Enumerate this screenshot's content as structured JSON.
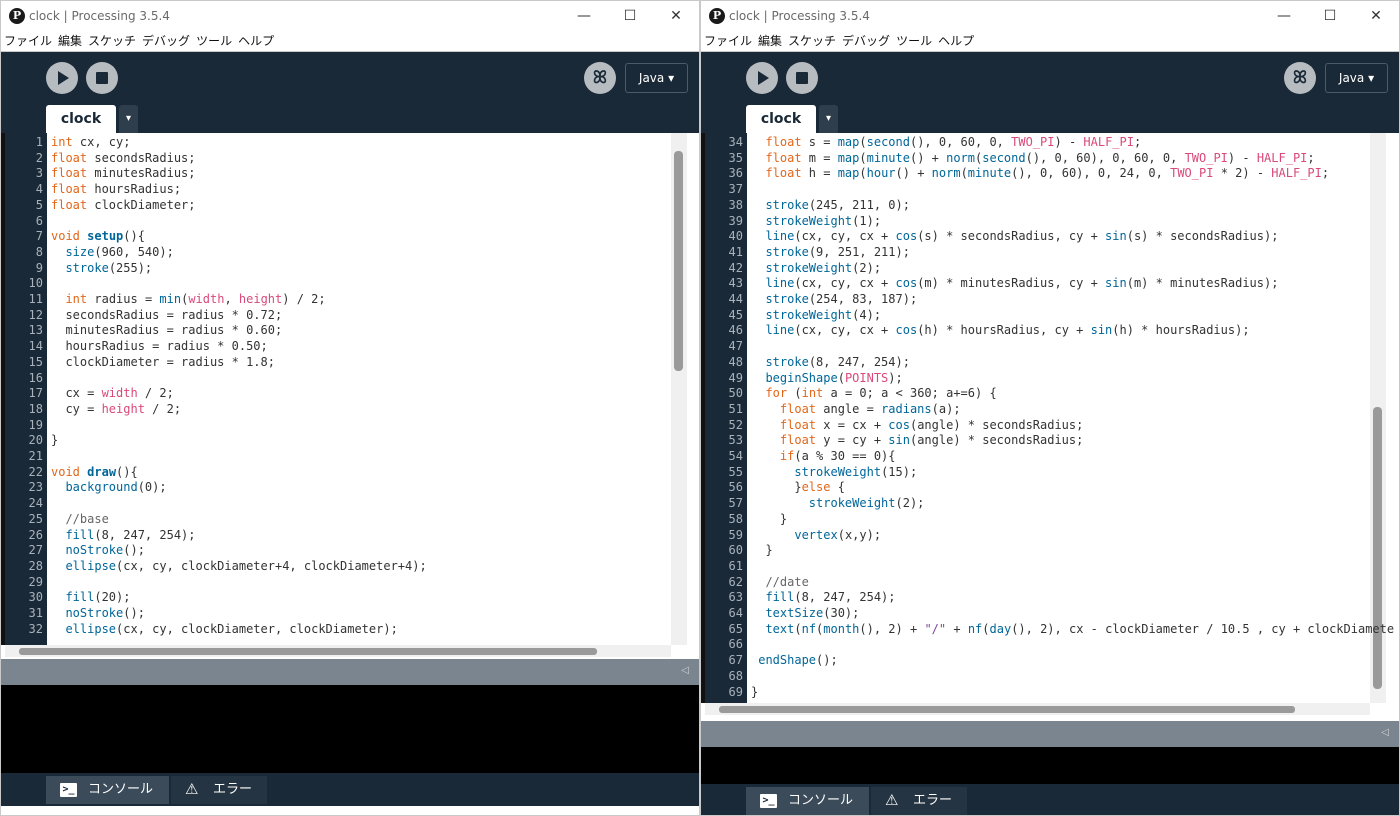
{
  "left": {
    "title": "clock | Processing 3.5.4",
    "app_icon": "P",
    "icons": {
      "minimize": "minimize-icon",
      "maximize": "maximize-icon",
      "close": "close-icon"
    },
    "window_controls": {
      "minimize": "—",
      "maximize": "☐",
      "close": "✕"
    },
    "menu": [
      "ファイル",
      "編集",
      "スケッチ",
      "デバッグ",
      "ツール",
      "ヘルプ"
    ],
    "mode_label": "Java ▾",
    "tab": {
      "label": "clock",
      "menu": "▾"
    },
    "footer": {
      "console": "コンソール",
      "errors": "エラー",
      "console_glyph": ">_",
      "errors_glyph": "⚠"
    },
    "collapse_glyph": "◁",
    "code": [
      {
        "n": "1",
        "t": [
          [
            "int",
            "kw"
          ],
          [
            " cx, cy;",
            ""
          ]
        ]
      },
      {
        "n": "2",
        "t": [
          [
            "float",
            "kw"
          ],
          [
            " secondsRadius;",
            ""
          ]
        ]
      },
      {
        "n": "3",
        "t": [
          [
            "float",
            "kw"
          ],
          [
            " minutesRadius;",
            ""
          ]
        ]
      },
      {
        "n": "4",
        "t": [
          [
            "float",
            "kw"
          ],
          [
            " hoursRadius;",
            ""
          ]
        ]
      },
      {
        "n": "5",
        "t": [
          [
            "float",
            "kw"
          ],
          [
            " clockDiameter;",
            ""
          ]
        ]
      },
      {
        "n": "6",
        "t": []
      },
      {
        "n": "7",
        "t": [
          [
            "void",
            "kw"
          ],
          [
            " ",
            ""
          ],
          [
            "setup",
            "fnb"
          ],
          [
            "(){",
            ""
          ]
        ]
      },
      {
        "n": "8",
        "t": [
          [
            "  ",
            ""
          ],
          [
            "size",
            "fn"
          ],
          [
            "(960, 540);",
            ""
          ]
        ]
      },
      {
        "n": "9",
        "t": [
          [
            "  ",
            ""
          ],
          [
            "stroke",
            "fn"
          ],
          [
            "(255);",
            ""
          ]
        ]
      },
      {
        "n": "10",
        "t": []
      },
      {
        "n": "11",
        "t": [
          [
            "  ",
            ""
          ],
          [
            "int",
            "kw"
          ],
          [
            " radius = ",
            ""
          ],
          [
            "min",
            "fn"
          ],
          [
            "(",
            ""
          ],
          [
            "width",
            "cn"
          ],
          [
            ", ",
            ""
          ],
          [
            "height",
            "cn"
          ],
          [
            ") / 2;",
            ""
          ]
        ]
      },
      {
        "n": "12",
        "t": [
          [
            "  secondsRadius = radius * 0.72;",
            ""
          ]
        ]
      },
      {
        "n": "13",
        "t": [
          [
            "  minutesRadius = radius * 0.60;",
            ""
          ]
        ]
      },
      {
        "n": "14",
        "t": [
          [
            "  hoursRadius = radius * 0.50;",
            ""
          ]
        ]
      },
      {
        "n": "15",
        "t": [
          [
            "  clockDiameter = radius * 1.8;",
            ""
          ]
        ]
      },
      {
        "n": "16",
        "t": []
      },
      {
        "n": "17",
        "t": [
          [
            "  cx = ",
            ""
          ],
          [
            "width",
            "cn"
          ],
          [
            " / 2;",
            ""
          ]
        ]
      },
      {
        "n": "18",
        "t": [
          [
            "  cy = ",
            ""
          ],
          [
            "height",
            "cn"
          ],
          [
            " / 2;",
            ""
          ]
        ]
      },
      {
        "n": "19",
        "t": []
      },
      {
        "n": "20",
        "t": [
          [
            "}",
            ""
          ]
        ]
      },
      {
        "n": "21",
        "t": []
      },
      {
        "n": "22",
        "t": [
          [
            "void",
            "kw"
          ],
          [
            " ",
            ""
          ],
          [
            "draw",
            "fnb"
          ],
          [
            "(){",
            ""
          ]
        ]
      },
      {
        "n": "23",
        "t": [
          [
            "  ",
            ""
          ],
          [
            "background",
            "fn"
          ],
          [
            "(0);",
            ""
          ]
        ]
      },
      {
        "n": "24",
        "t": []
      },
      {
        "n": "25",
        "t": [
          [
            "  //base",
            "cm"
          ]
        ]
      },
      {
        "n": "26",
        "t": [
          [
            "  ",
            ""
          ],
          [
            "fill",
            "fn"
          ],
          [
            "(8, 247, 254);",
            ""
          ]
        ]
      },
      {
        "n": "27",
        "t": [
          [
            "  ",
            ""
          ],
          [
            "noStroke",
            "fn"
          ],
          [
            "();",
            ""
          ]
        ]
      },
      {
        "n": "28",
        "t": [
          [
            "  ",
            ""
          ],
          [
            "ellipse",
            "fn"
          ],
          [
            "(cx, cy, clockDiameter+4, clockDiameter+4);",
            ""
          ]
        ]
      },
      {
        "n": "29",
        "t": []
      },
      {
        "n": "30",
        "t": [
          [
            "  ",
            ""
          ],
          [
            "fill",
            "fn"
          ],
          [
            "(20);",
            ""
          ]
        ]
      },
      {
        "n": "31",
        "t": [
          [
            "  ",
            ""
          ],
          [
            "noStroke",
            "fn"
          ],
          [
            "();",
            ""
          ]
        ]
      },
      {
        "n": "32",
        "t": [
          [
            "  ",
            ""
          ],
          [
            "ellipse",
            "fn"
          ],
          [
            "(cx, cy, clockDiameter, clockDiameter);",
            ""
          ]
        ]
      }
    ]
  },
  "right": {
    "title": "clock | Processing 3.5.4",
    "app_icon": "P",
    "window_controls": {
      "minimize": "—",
      "maximize": "☐",
      "close": "✕"
    },
    "menu": [
      "ファイル",
      "編集",
      "スケッチ",
      "デバッグ",
      "ツール",
      "ヘルプ"
    ],
    "mode_label": "Java ▾",
    "tab": {
      "label": "clock",
      "menu": "▾"
    },
    "footer": {
      "console": "コンソール",
      "errors": "エラー",
      "console_glyph": ">_",
      "errors_glyph": "⚠"
    },
    "collapse_glyph": "◁",
    "code": [
      {
        "n": "34",
        "t": [
          [
            "  ",
            ""
          ],
          [
            "float",
            "kw"
          ],
          [
            " s = ",
            ""
          ],
          [
            "map",
            "fn"
          ],
          [
            "(",
            ""
          ],
          [
            "second",
            "fn"
          ],
          [
            "(), 0, 60, 0, ",
            ""
          ],
          [
            "TWO_PI",
            "cn"
          ],
          [
            ") - ",
            ""
          ],
          [
            "HALF_PI",
            "cn"
          ],
          [
            ";",
            ""
          ]
        ]
      },
      {
        "n": "35",
        "t": [
          [
            "  ",
            ""
          ],
          [
            "float",
            "kw"
          ],
          [
            " m = ",
            ""
          ],
          [
            "map",
            "fn"
          ],
          [
            "(",
            ""
          ],
          [
            "minute",
            "fn"
          ],
          [
            "() + ",
            ""
          ],
          [
            "norm",
            "fn"
          ],
          [
            "(",
            ""
          ],
          [
            "second",
            "fn"
          ],
          [
            "(), 0, 60), 0, 60, 0, ",
            ""
          ],
          [
            "TWO_PI",
            "cn"
          ],
          [
            ") - ",
            ""
          ],
          [
            "HALF_PI",
            "cn"
          ],
          [
            ";",
            ""
          ]
        ]
      },
      {
        "n": "36",
        "t": [
          [
            "  ",
            ""
          ],
          [
            "float",
            "kw"
          ],
          [
            " h = ",
            ""
          ],
          [
            "map",
            "fn"
          ],
          [
            "(",
            ""
          ],
          [
            "hour",
            "fn"
          ],
          [
            "() + ",
            ""
          ],
          [
            "norm",
            "fn"
          ],
          [
            "(",
            ""
          ],
          [
            "minute",
            "fn"
          ],
          [
            "(), 0, 60), 0, 24, 0, ",
            ""
          ],
          [
            "TWO_PI",
            "cn"
          ],
          [
            " * 2) - ",
            ""
          ],
          [
            "HALF_PI",
            "cn"
          ],
          [
            ";",
            ""
          ]
        ]
      },
      {
        "n": "37",
        "t": []
      },
      {
        "n": "38",
        "t": [
          [
            "  ",
            ""
          ],
          [
            "stroke",
            "fn"
          ],
          [
            "(245, 211, 0);",
            ""
          ]
        ]
      },
      {
        "n": "39",
        "t": [
          [
            "  ",
            ""
          ],
          [
            "strokeWeight",
            "fn"
          ],
          [
            "(1);",
            ""
          ]
        ]
      },
      {
        "n": "40",
        "t": [
          [
            "  ",
            ""
          ],
          [
            "line",
            "fn"
          ],
          [
            "(cx, cy, cx + ",
            ""
          ],
          [
            "cos",
            "fn"
          ],
          [
            "(s) * secondsRadius, cy + ",
            ""
          ],
          [
            "sin",
            "fn"
          ],
          [
            "(s) * secondsRadius);",
            ""
          ]
        ]
      },
      {
        "n": "41",
        "t": [
          [
            "  ",
            ""
          ],
          [
            "stroke",
            "fn"
          ],
          [
            "(9, 251, 211);",
            ""
          ]
        ]
      },
      {
        "n": "42",
        "t": [
          [
            "  ",
            ""
          ],
          [
            "strokeWeight",
            "fn"
          ],
          [
            "(2);",
            ""
          ]
        ]
      },
      {
        "n": "43",
        "t": [
          [
            "  ",
            ""
          ],
          [
            "line",
            "fn"
          ],
          [
            "(cx, cy, cx + ",
            ""
          ],
          [
            "cos",
            "fn"
          ],
          [
            "(m) * minutesRadius, cy + ",
            ""
          ],
          [
            "sin",
            "fn"
          ],
          [
            "(m) * minutesRadius);",
            ""
          ]
        ]
      },
      {
        "n": "44",
        "t": [
          [
            "  ",
            ""
          ],
          [
            "stroke",
            "fn"
          ],
          [
            "(254, 83, 187);",
            ""
          ]
        ]
      },
      {
        "n": "45",
        "t": [
          [
            "  ",
            ""
          ],
          [
            "strokeWeight",
            "fn"
          ],
          [
            "(4);",
            ""
          ]
        ]
      },
      {
        "n": "46",
        "t": [
          [
            "  ",
            ""
          ],
          [
            "line",
            "fn"
          ],
          [
            "(cx, cy, cx + ",
            ""
          ],
          [
            "cos",
            "fn"
          ],
          [
            "(h) * hoursRadius, cy + ",
            ""
          ],
          [
            "sin",
            "fn"
          ],
          [
            "(h) * hoursRadius);",
            ""
          ]
        ]
      },
      {
        "n": "47",
        "t": []
      },
      {
        "n": "48",
        "t": [
          [
            "  ",
            ""
          ],
          [
            "stroke",
            "fn"
          ],
          [
            "(8, 247, 254);",
            ""
          ]
        ]
      },
      {
        "n": "49",
        "t": [
          [
            "  ",
            ""
          ],
          [
            "beginShape",
            "fn"
          ],
          [
            "(",
            ""
          ],
          [
            "POINTS",
            "cn"
          ],
          [
            ");",
            ""
          ]
        ]
      },
      {
        "n": "50",
        "t": [
          [
            "  ",
            ""
          ],
          [
            "for",
            "kw"
          ],
          [
            " (",
            ""
          ],
          [
            "int",
            "kw"
          ],
          [
            " a = 0; a < 360; a+=6) {",
            ""
          ]
        ]
      },
      {
        "n": "51",
        "t": [
          [
            "    ",
            ""
          ],
          [
            "float",
            "kw"
          ],
          [
            " angle = ",
            ""
          ],
          [
            "radians",
            "fn"
          ],
          [
            "(a);",
            ""
          ]
        ]
      },
      {
        "n": "52",
        "t": [
          [
            "    ",
            ""
          ],
          [
            "float",
            "kw"
          ],
          [
            " x = cx + ",
            ""
          ],
          [
            "cos",
            "fn"
          ],
          [
            "(angle) * secondsRadius;",
            ""
          ]
        ]
      },
      {
        "n": "53",
        "t": [
          [
            "    ",
            ""
          ],
          [
            "float",
            "kw"
          ],
          [
            " y = cy + ",
            ""
          ],
          [
            "sin",
            "fn"
          ],
          [
            "(angle) * secondsRadius;",
            ""
          ]
        ]
      },
      {
        "n": "54",
        "t": [
          [
            "    ",
            ""
          ],
          [
            "if",
            "kw"
          ],
          [
            "(a % 30 == 0){",
            ""
          ]
        ]
      },
      {
        "n": "55",
        "t": [
          [
            "      ",
            ""
          ],
          [
            "strokeWeight",
            "fn"
          ],
          [
            "(15);",
            ""
          ]
        ]
      },
      {
        "n": "56",
        "t": [
          [
            "      }",
            ""
          ],
          [
            "else",
            "kw"
          ],
          [
            " {",
            ""
          ]
        ]
      },
      {
        "n": "57",
        "t": [
          [
            "        ",
            ""
          ],
          [
            "strokeWeight",
            "fn"
          ],
          [
            "(2);",
            ""
          ]
        ]
      },
      {
        "n": "58",
        "t": [
          [
            "    }",
            ""
          ]
        ]
      },
      {
        "n": "59",
        "t": [
          [
            "      ",
            ""
          ],
          [
            "vertex",
            "fn"
          ],
          [
            "(x,y);",
            ""
          ]
        ]
      },
      {
        "n": "60",
        "t": [
          [
            "  }",
            ""
          ]
        ]
      },
      {
        "n": "61",
        "t": []
      },
      {
        "n": "62",
        "t": [
          [
            "  //date",
            "cm"
          ]
        ]
      },
      {
        "n": "63",
        "t": [
          [
            "  ",
            ""
          ],
          [
            "fill",
            "fn"
          ],
          [
            "(8, 247, 254);",
            ""
          ]
        ]
      },
      {
        "n": "64",
        "t": [
          [
            "  ",
            ""
          ],
          [
            "textSize",
            "fn"
          ],
          [
            "(30);",
            ""
          ]
        ]
      },
      {
        "n": "65",
        "t": [
          [
            "  ",
            ""
          ],
          [
            "text",
            "fn"
          ],
          [
            "(",
            ""
          ],
          [
            "nf",
            "fn"
          ],
          [
            "(",
            ""
          ],
          [
            "month",
            "fn"
          ],
          [
            "(), 2) + ",
            ""
          ],
          [
            "\"/\"",
            "st"
          ],
          [
            " + ",
            ""
          ],
          [
            "nf",
            "fn"
          ],
          [
            "(",
            ""
          ],
          [
            "day",
            "fn"
          ],
          [
            "(), 2), cx - clockDiameter / 10.5 , cy + clockDiamete",
            ""
          ]
        ]
      },
      {
        "n": "66",
        "t": []
      },
      {
        "n": "67",
        "t": [
          [
            " ",
            ""
          ],
          [
            "endShape",
            "fn"
          ],
          [
            "();",
            ""
          ]
        ]
      },
      {
        "n": "68",
        "t": []
      },
      {
        "n": "69",
        "t": [
          [
            "}",
            ""
          ]
        ]
      }
    ]
  }
}
